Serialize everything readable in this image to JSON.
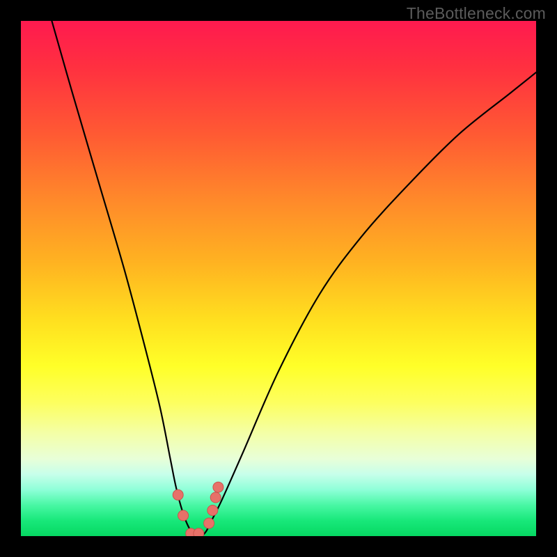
{
  "watermark": "TheBottleneck.com",
  "chart_data": {
    "type": "line",
    "title": "",
    "xlabel": "",
    "ylabel": "",
    "xlim": [
      0,
      100
    ],
    "ylim": [
      0,
      100
    ],
    "grid": false,
    "series": [
      {
        "name": "curve",
        "x": [
          6,
          10,
          15,
          20,
          24,
          27,
          29,
          30,
          31,
          32,
          33,
          34,
          35,
          36,
          37,
          39,
          43,
          50,
          58,
          66,
          75,
          85,
          95,
          100
        ],
        "values": [
          100,
          86,
          69,
          52,
          37,
          25,
          15,
          10,
          6,
          3,
          1,
          0,
          0,
          1,
          3,
          7,
          16,
          32,
          47,
          58,
          68,
          78,
          86,
          90
        ]
      }
    ],
    "markers": {
      "x": [
        30.5,
        31.5,
        33,
        34.5,
        36.5,
        37.2,
        37.8,
        38.3
      ],
      "values": [
        8,
        4,
        0.5,
        0.5,
        2.5,
        5,
        7.5,
        9.5
      ]
    }
  }
}
